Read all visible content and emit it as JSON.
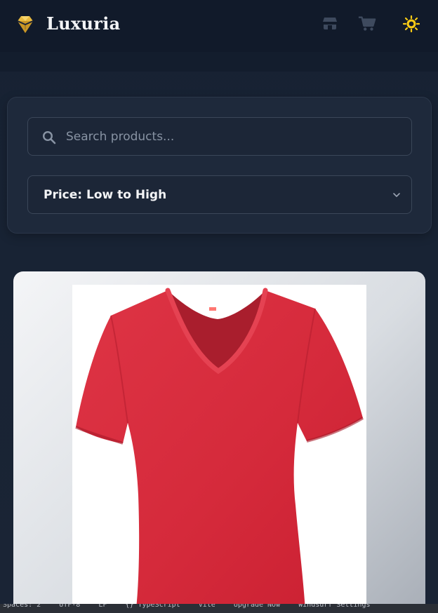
{
  "app": {
    "brand_name": "Luxuria",
    "icons": {
      "logo": "diamond-icon",
      "store": "store-icon",
      "cart": "cart-icon",
      "theme": "sun-icon"
    },
    "colors": {
      "accent": "#facc15",
      "header_bg": "#111a2a",
      "page_bg": "#172131",
      "card_bg": "#1e293b",
      "border": "#3b4759",
      "product_color": "#d62a3a"
    }
  },
  "search": {
    "placeholder": "Search products...",
    "value": ""
  },
  "sort": {
    "selected": "Price: Low to High"
  },
  "product": {
    "image_name": "red-v-neck-t-shirt"
  },
  "status_bar": {
    "items": [
      "Spaces: 2",
      "UTF-8",
      "LF",
      "{} TypeScript",
      "Vite",
      "Upgrade Now",
      "Windsurf Settings"
    ]
  }
}
